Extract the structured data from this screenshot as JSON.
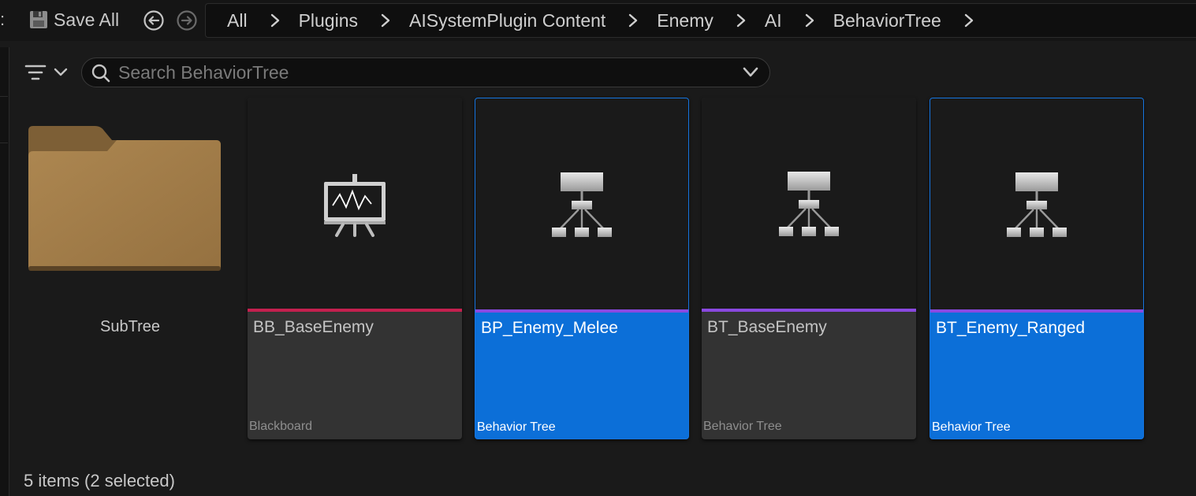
{
  "toolbar": {
    "colon": ":",
    "save_all": "Save All"
  },
  "breadcrumb": [
    "All",
    "Plugins",
    "AISystemPlugin Content",
    "Enemy",
    "AI",
    "BehaviorTree"
  ],
  "search": {
    "placeholder": "Search BehaviorTree",
    "value": ""
  },
  "folder": {
    "name": "SubTree"
  },
  "assets": [
    {
      "name": "BB_BaseEnemy",
      "type": "Blackboard",
      "icon": "blackboard-icon",
      "stripe_color": "#c4204f",
      "selected": false
    },
    {
      "name": "BP_Enemy_Melee",
      "type": "Behavior Tree",
      "icon": "behavior-tree-icon",
      "stripe_color": "#8a49e0",
      "selected": true
    },
    {
      "name": "BT_BaseEnemy",
      "type": "Behavior Tree",
      "icon": "behavior-tree-icon",
      "stripe_color": "#8a49e0",
      "selected": false
    },
    {
      "name": "BT_Enemy_Ranged",
      "type": "Behavior Tree",
      "icon": "behavior-tree-icon",
      "stripe_color": "#8a49e0",
      "selected": true
    }
  ],
  "status": "5 items (2 selected)",
  "colors": {
    "selection": "#0c6fd8",
    "folder": "#a07c4b"
  }
}
